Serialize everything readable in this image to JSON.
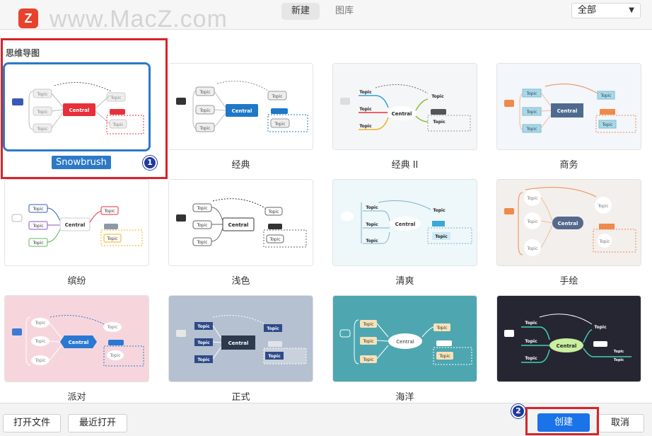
{
  "header": {
    "logo_letter": "Z",
    "watermark": "www.MacZ.com",
    "tabs": [
      {
        "label": "新建",
        "active": true
      },
      {
        "label": "图库",
        "active": false
      }
    ],
    "filter": {
      "selected": "全部"
    }
  },
  "section": {
    "title": "思维导图"
  },
  "templates": [
    {
      "name": "Snowbrush",
      "selected": true
    },
    {
      "name": "经典"
    },
    {
      "name": "经典 II"
    },
    {
      "name": "商务"
    },
    {
      "name": "缤纷"
    },
    {
      "name": "浅色"
    },
    {
      "name": "清爽"
    },
    {
      "name": "手绘"
    },
    {
      "name": "派对"
    },
    {
      "name": "正式"
    },
    {
      "name": "海洋"
    },
    {
      "name": ""
    }
  ],
  "thumb_text": {
    "central": "Central",
    "topic": "Topic",
    "subtopic": "Topic"
  },
  "annotations": {
    "badge1": "1",
    "badge2": "2"
  },
  "footer": {
    "open_file": "打开文件",
    "recent": "最近打开",
    "create": "创建",
    "cancel": "取消"
  },
  "colors": {
    "accent": "#2d79c7",
    "highlight": "#d9232a",
    "primary_button": "#1a73e8"
  }
}
